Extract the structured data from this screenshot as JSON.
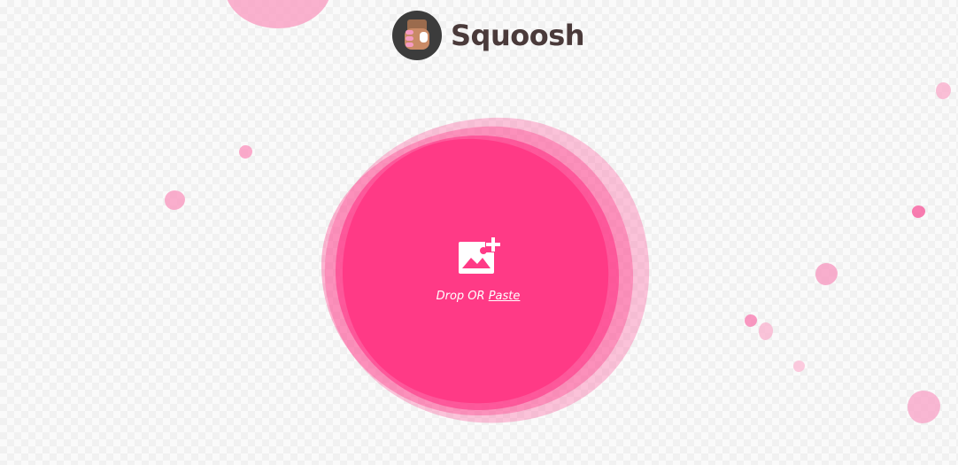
{
  "app": {
    "logo_icon": "squoosh-hand-logo-icon",
    "title": "Squoosh"
  },
  "drop_zone": {
    "icon": "add-image-icon",
    "drop_label": "Drop OR",
    "paste_label": "Paste"
  },
  "colors": {
    "accent": "#ff3385",
    "accent_light": "#f9a3c6",
    "logo_bg": "#3c3c3c",
    "title_text": "#4a3a3a"
  }
}
